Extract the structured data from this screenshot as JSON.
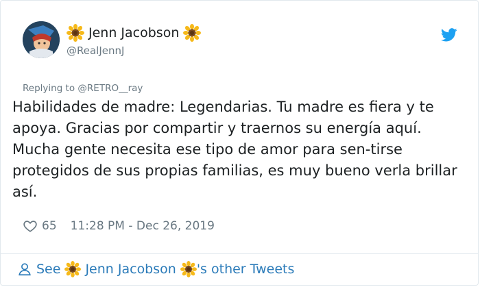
{
  "author": {
    "display_name": "Jenn Jacobson",
    "handle": "@RealJennJ"
  },
  "reply": {
    "prefix": "Replying to ",
    "mention": "@RETRO__ray"
  },
  "tweet": {
    "text": "Habilidades de madre: Legendarias. Tu madre es fiera y te apoya. Gracias por compartir y traernos su energía aquí. Mucha gente necesita ese tipo de amor para sen-tirse protegidos de sus propias familias, es muy bueno verla brillar así.",
    "like_count": "65",
    "timestamp": "11:28 PM - Dec 26, 2019"
  },
  "footer": {
    "see": "See",
    "name": "Jenn Jacobson",
    "suffix": "'s other Tweets"
  },
  "colors": {
    "link": "#2b7bb9",
    "twitter_blue": "#1da1f2",
    "meta_gray": "#697882"
  },
  "icons": [
    "sunflower-icon",
    "twitter-bird-icon",
    "heart-icon",
    "user-icon"
  ]
}
